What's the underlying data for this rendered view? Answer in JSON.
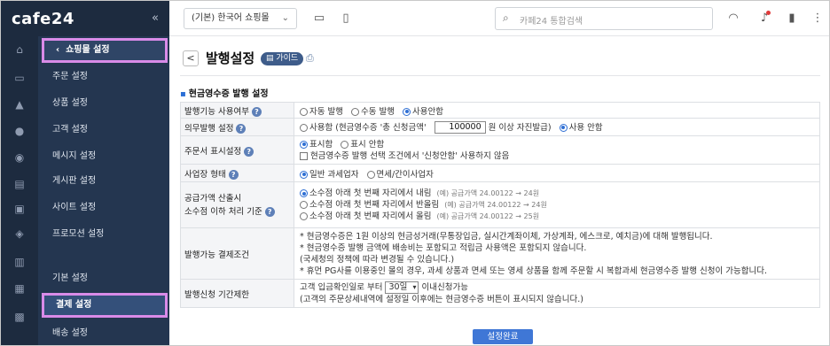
{
  "app": {
    "logo": "cafe24",
    "collapse_glyph": "«"
  },
  "topbar": {
    "shop_select": "(기본) 한국어 쇼핑몰",
    "search_placeholder": "카페24 통합검색"
  },
  "sidebar": {
    "back_item": "쇼핑몰 설정",
    "items": [
      "주문 설정",
      "상품 설정",
      "고객 설정",
      "메시지 설정",
      "게시판 설정",
      "사이트 설정",
      "프로모션 설정",
      "기본 설정",
      "결제 설정",
      "배송 설정"
    ]
  },
  "page": {
    "back_glyph": "<",
    "title": "발행설정",
    "guide_label": "가이드",
    "section_title": "현금영수증 발행 설정",
    "submit_label": "설정완료"
  },
  "form": {
    "row1": {
      "label": "발행기능 사용여부",
      "opts": [
        "자동 발행",
        "수동 발행",
        "사용안함"
      ]
    },
    "row2": {
      "label": "의무발행 설정",
      "opt1_pre": "사용함 (현금영수증 '총 신청금액'",
      "amount": "100000",
      "opt1_post": "원 이상 자진발급)",
      "opt2": "사용 안함"
    },
    "row3": {
      "label": "주문서 표시설정",
      "opts": [
        "표시함",
        "표시 안함"
      ],
      "check": "현금영수증 발행 선택 조건에서 '신청안함' 사용하지 않음"
    },
    "row4": {
      "label": "사업장 형태",
      "opts": [
        "일반 과세업자",
        "면세/간이사업자"
      ]
    },
    "row5": {
      "label1": "공급가액 산출시",
      "label2": "소수점 이하 처리 기준",
      "opts": [
        "소수점 아래 첫 번째 자리에서 내림",
        "소수점 아래 첫 번째 자리에서 반올림",
        "소수점 아래 첫 번째 자리에서 올림"
      ],
      "egs": [
        "(예) 공급가액 24.00122 → 24원",
        "(예) 공급가액 24.00122 → 24원",
        "(예) 공급가액 24.00122 → 25원"
      ]
    },
    "row6": {
      "label": "발행가능 결제조건",
      "lines": [
        "* 현금영수증은 1원 이상의 현금성거래(무통장입금, 실시간계좌이체, 가상계좌, 에스크로, 예치금)에 대해 발행됩니다.",
        "* 현금영수증 발행 금액에 배송비는 포함되고 적립금 사용액은 포함되지 않습니다.",
        "(국세청의 정책에 따라 변경될 수 있습니다.)",
        "* 휴먼 PG사를 이용중인 몰의 경우, 과세 상품과 면세 또는 영세 상품을 함께 주문할 시 복합과세 현금영수증 발행 신청이 가능합니다."
      ]
    },
    "row7": {
      "label": "발행신청 기간제한",
      "pre": "고객 입금확인일로 부터",
      "period": "30일",
      "post": "이내신청가능",
      "note": "(고객의 주문상세내역에 설정일 이후에는 현금영수증 버튼이 표시되지 않습니다.)"
    }
  },
  "colors": {
    "accent": "#3f77d6",
    "sidebar": "#243650",
    "highlight": "#d98be8"
  }
}
